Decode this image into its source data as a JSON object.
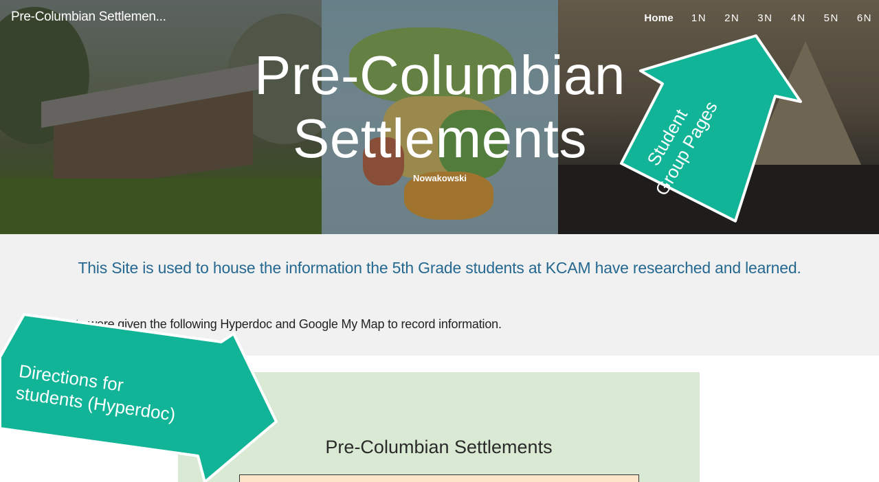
{
  "header": {
    "site_title": "Pre-Columbian Settlemen...",
    "nav": [
      {
        "label": "Home",
        "active": true
      },
      {
        "label": "1N",
        "active": false
      },
      {
        "label": "2N",
        "active": false
      },
      {
        "label": "3N",
        "active": false
      },
      {
        "label": "4N",
        "active": false
      },
      {
        "label": "5N",
        "active": false
      },
      {
        "label": "6N",
        "active": false
      }
    ]
  },
  "hero": {
    "title_line1": "Pre-Columbian",
    "title_line2": "Settlements",
    "subtitle": "Nowakowski"
  },
  "intro": {
    "heading": "This Site is used to house the information the 5th Grade students at KCAM have researched and learned.",
    "text": "Students were given the following Hyperdoc and Google My Map to record information."
  },
  "doc_embed": {
    "title": "Pre-Columbian Settlements"
  },
  "annotations": {
    "student_pages_line1": "Student",
    "student_pages_line2": "Group Pages",
    "directions_line1": "Directions for",
    "directions_line2": "students (Hyperdoc)"
  },
  "colors": {
    "arrow": "#12b497",
    "heading_blue": "#256890",
    "doc_bg": "#d9e9d3",
    "intro_bg": "#f1f1f1"
  }
}
